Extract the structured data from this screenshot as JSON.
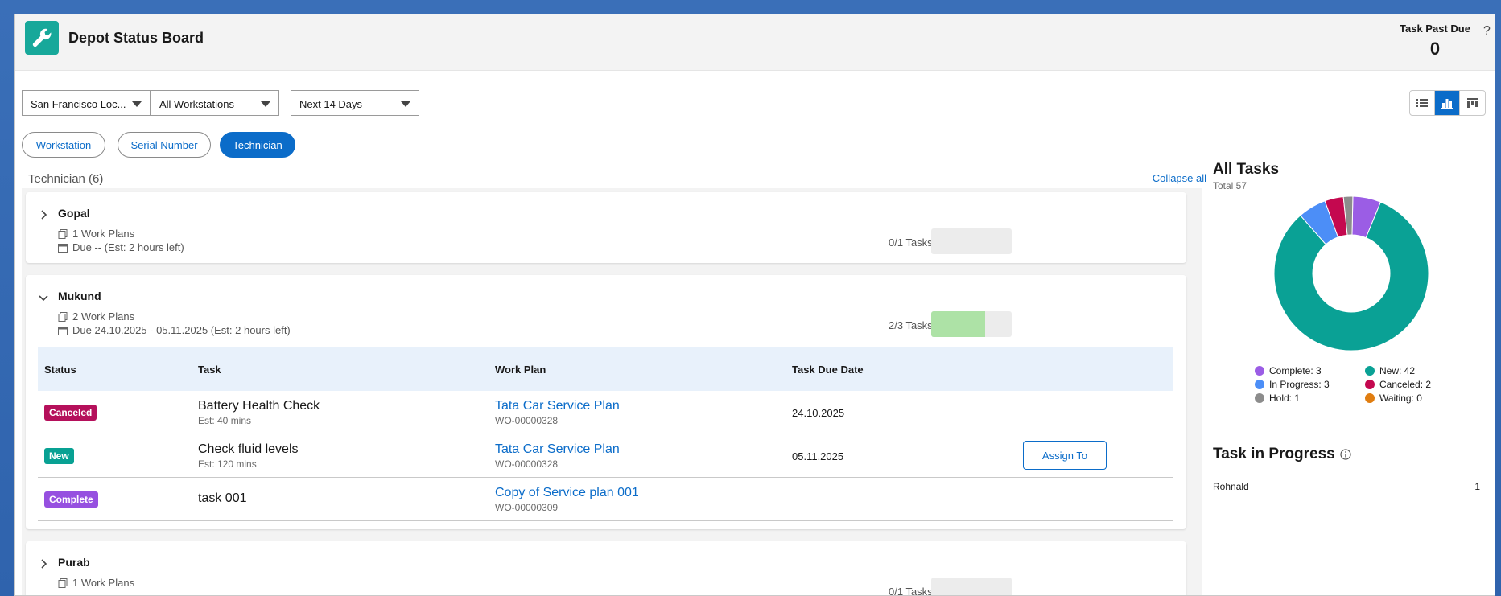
{
  "header": {
    "title": "Depot Status Board",
    "task_past_due_label": "Task Past Due",
    "task_past_due_value": "0",
    "help_label": "?"
  },
  "filters": {
    "location": "San Francisco Loc...",
    "workstation": "All Workstations",
    "period": "Next 14 Days"
  },
  "view_toggle": {
    "options": [
      "list-view-icon",
      "chart-view-icon",
      "board-view-icon"
    ],
    "active": "chart-view-icon"
  },
  "group_by": {
    "options": [
      "Workstation",
      "Serial Number",
      "Technician"
    ],
    "active": "Technician"
  },
  "list": {
    "heading": "Technician (6)",
    "collapse_all": "Collapse all",
    "table_headers": [
      "Status",
      "Task",
      "Work Plan",
      "Task Due Date"
    ],
    "technicians": [
      {
        "name": "Gopal",
        "work_plans": "1 Work Plans",
        "due": "Due -- (Est: 2 hours left)",
        "tasks": "0/1 Tasks",
        "progress": 0.0,
        "expanded": false
      },
      {
        "name": "Mukund",
        "work_plans": "2 Work Plans",
        "due": "Due 24.10.2025 - 05.11.2025 (Est: 2 hours left)",
        "tasks": "2/3 Tasks",
        "progress": 0.67,
        "expanded": true,
        "rows": [
          {
            "status": "Canceled",
            "task": "Battery Health Check",
            "est": "Est: 40 mins",
            "plan": "Tata Car Service Plan",
            "plan_id": "WO-00000328",
            "due": "24.10.2025",
            "action": ""
          },
          {
            "status": "New",
            "task": "Check fluid levels",
            "est": "Est: 120 mins",
            "plan": "Tata Car Service Plan",
            "plan_id": "WO-00000328",
            "due": "05.11.2025",
            "action": "Assign To"
          },
          {
            "status": "Complete",
            "task": "task 001",
            "est": "",
            "plan": "Copy of Service plan 001",
            "plan_id": "WO-00000309",
            "due": "",
            "action": ""
          }
        ]
      },
      {
        "name": "Purab",
        "work_plans": "1 Work Plans",
        "tasks": "0/1 Tasks",
        "progress": 0.0,
        "expanded": false
      }
    ]
  },
  "all_tasks": {
    "title": "All Tasks",
    "total": "Total 57",
    "legend": [
      {
        "label": "Complete: 3",
        "color": "#9b5de5"
      },
      {
        "label": "New: 42",
        "color": "#0aa195"
      },
      {
        "label": "In Progress: 3",
        "color": "#4c8ef7"
      },
      {
        "label": "Canceled: 2",
        "color": "#c4084f"
      },
      {
        "label": "Hold: 1",
        "color": "#8c8c8c"
      },
      {
        "label": "Waiting: 0",
        "color": "#e07d10"
      }
    ]
  },
  "task_in_progress": {
    "title": "Task in Progress",
    "rows": [
      {
        "name": "Rohnald",
        "count": "1"
      }
    ]
  },
  "colors": {
    "brand_blue": "#0b6cc9",
    "canceled": "#b5105b",
    "new": "#08a193",
    "complete": "#9650e0"
  },
  "chart_data": {
    "type": "pie",
    "title": "All Tasks",
    "categories": [
      "Complete",
      "New",
      "In Progress",
      "Canceled",
      "Hold",
      "Waiting"
    ],
    "values": [
      3,
      42,
      3,
      2,
      1,
      0
    ]
  }
}
